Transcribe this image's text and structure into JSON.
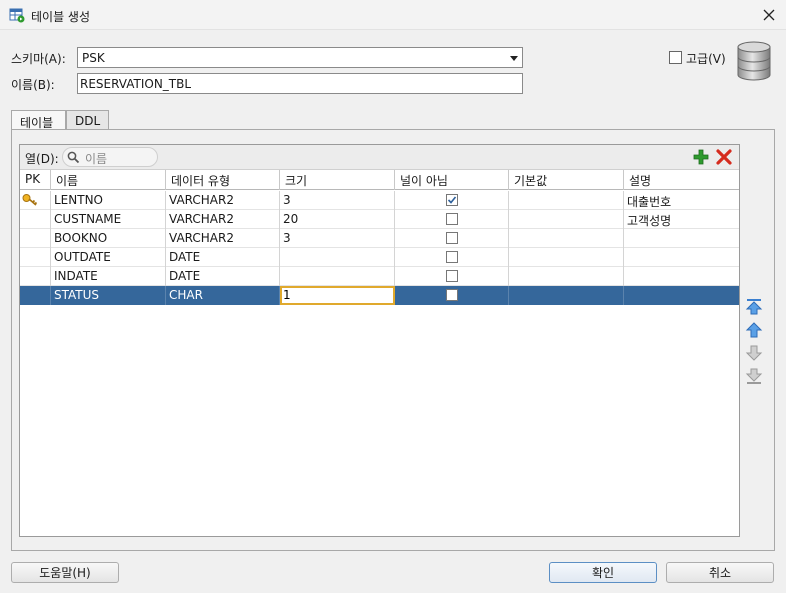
{
  "window": {
    "title": "테이블 생성"
  },
  "schema": {
    "label": "스키마(A):",
    "value": "PSK"
  },
  "name": {
    "label": "이름(B):",
    "value": "RESERVATION_TBL"
  },
  "advanced": {
    "label": "고급(V)",
    "checked": false
  },
  "tabs": [
    {
      "label": "테이블",
      "active": true
    },
    {
      "label": "DDL",
      "active": false
    }
  ],
  "columns_panel": {
    "label": "열(D):",
    "search_placeholder": "이름",
    "add_tooltip": "add",
    "remove_tooltip": "remove"
  },
  "grid": {
    "headers": [
      "PK",
      "이름",
      "데이터 유형",
      "크기",
      "널이 아님",
      "기본값",
      "설명"
    ],
    "rows": [
      {
        "pk": true,
        "name": "LENTNO",
        "type": "VARCHAR2",
        "size": "3",
        "not_null": true,
        "default": "",
        "comment": "대출번호",
        "selected": false
      },
      {
        "pk": false,
        "name": "CUSTNAME",
        "type": "VARCHAR2",
        "size": "20",
        "not_null": false,
        "default": "",
        "comment": "고객성명",
        "selected": false
      },
      {
        "pk": false,
        "name": "BOOKNO",
        "type": "VARCHAR2",
        "size": "3",
        "not_null": false,
        "default": "",
        "comment": "",
        "selected": false
      },
      {
        "pk": false,
        "name": "OUTDATE",
        "type": "DATE",
        "size": "",
        "not_null": false,
        "default": "",
        "comment": "",
        "selected": false
      },
      {
        "pk": false,
        "name": "INDATE",
        "type": "DATE",
        "size": "",
        "not_null": false,
        "default": "",
        "comment": "",
        "selected": false
      },
      {
        "pk": false,
        "name": "STATUS",
        "type": "CHAR",
        "size": "1",
        "not_null": false,
        "default": "",
        "comment": "",
        "selected": true
      }
    ]
  },
  "buttons": {
    "help": "도움말(H)",
    "ok": "확인",
    "cancel": "취소"
  },
  "colors": {
    "selection": "#35679b",
    "edit_outline": "#e0a92d",
    "add": "#2e9a2e",
    "remove": "#d52b1e",
    "arrow": "#3a7fd0"
  }
}
